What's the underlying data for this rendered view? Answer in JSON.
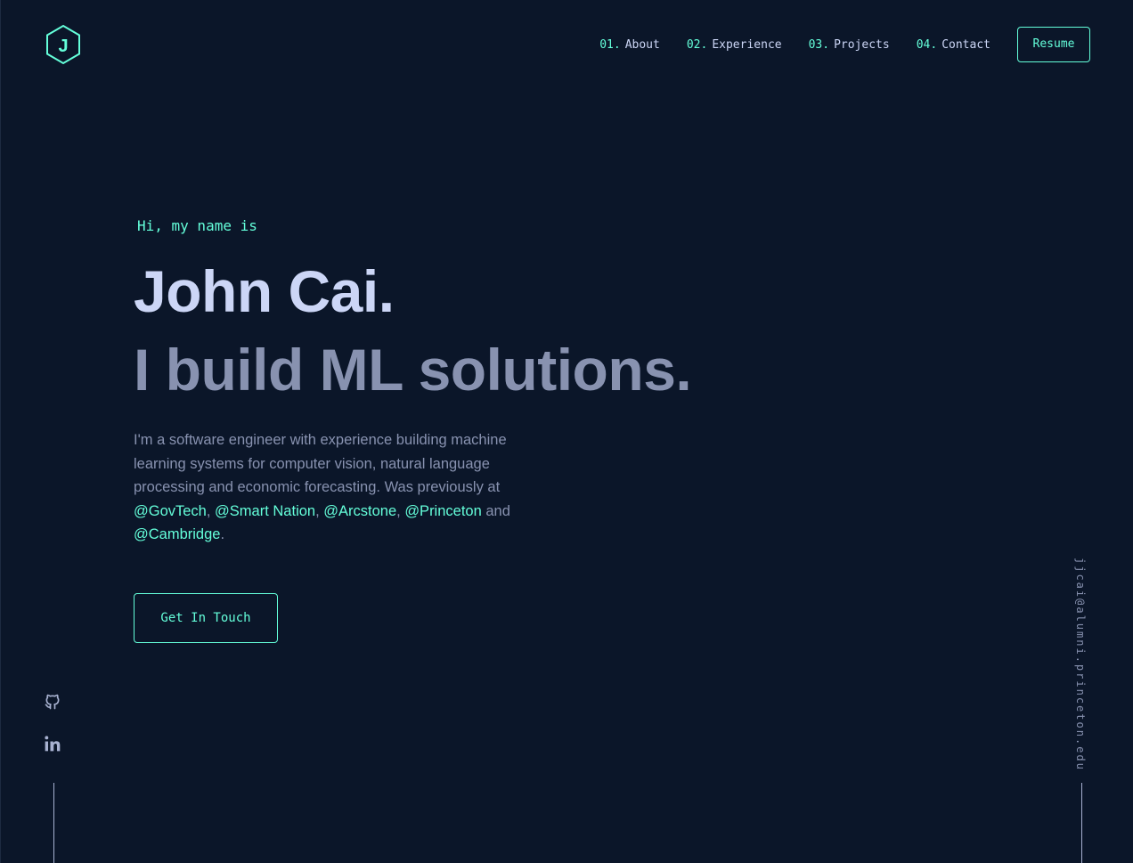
{
  "logo": {
    "letter": "J",
    "icon": "hexagon-logo-icon"
  },
  "nav": {
    "items": [
      {
        "num": "01.",
        "label": "About"
      },
      {
        "num": "02.",
        "label": "Experience"
      },
      {
        "num": "03.",
        "label": "Projects"
      },
      {
        "num": "04.",
        "label": "Contact"
      }
    ],
    "resume_label": "Resume"
  },
  "hero": {
    "greeting": "Hi, my name is",
    "name": "John Cai.",
    "tagline": "I build ML solutions.",
    "bio": {
      "intro": "I'm a software engineer with experience building machine learning systems for computer vision, natural language processing and economic forecasting. Was previously at ",
      "links": [
        "@GovTech",
        "@Smart Nation",
        "@Arcstone",
        "@Princeton",
        "@Cambridge"
      ],
      "sep1": ", ",
      "sep2": ", ",
      "sep3": ", ",
      "sep4": " and ",
      "end": "."
    },
    "cta_label": "Get In Touch"
  },
  "social": [
    {
      "icon": "github-icon"
    },
    {
      "icon": "linkedin-icon"
    }
  ],
  "email": "jjcai@alumni.princeton.edu",
  "colors": {
    "background": "#0b1629",
    "accent": "#64ffda",
    "heading": "#ccd6f6",
    "text": "#8892b0"
  }
}
